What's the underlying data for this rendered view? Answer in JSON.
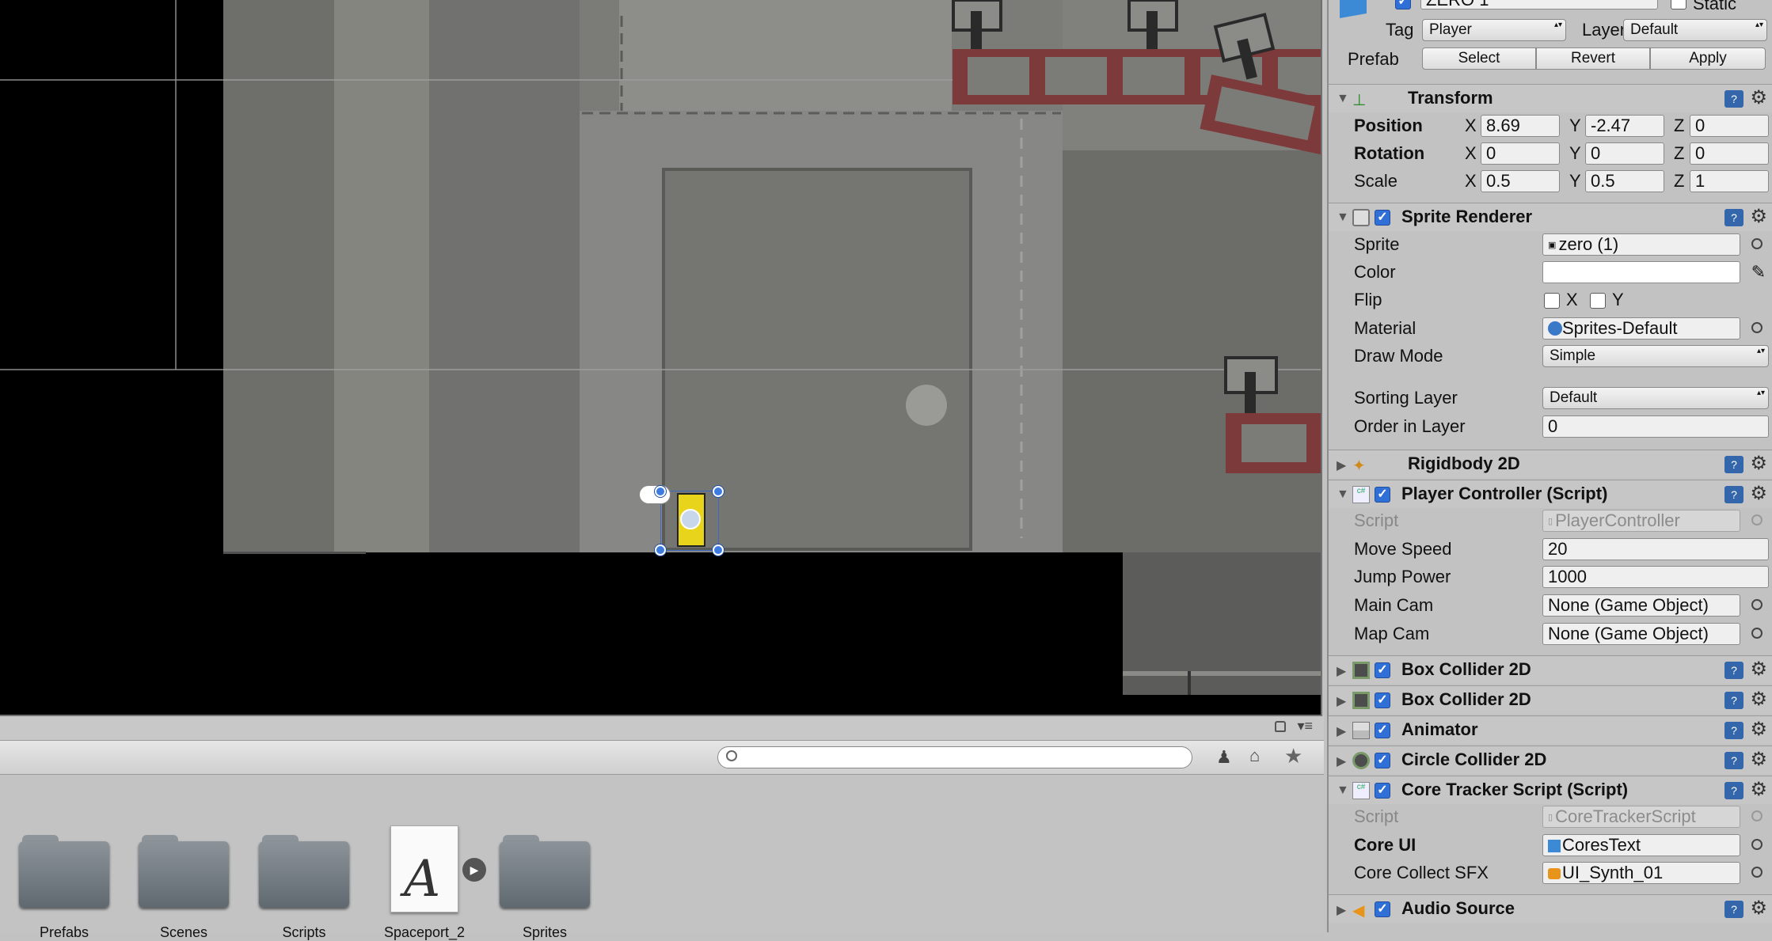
{
  "header": {
    "object_name": "ZERO 1",
    "static_label": "Static",
    "tag_label": "Tag",
    "tag_value": "Player",
    "layer_label": "Layer",
    "layer_value": "Default",
    "prefab_label": "Prefab",
    "select": "Select",
    "revert": "Revert",
    "apply": "Apply"
  },
  "transform": {
    "title": "Transform",
    "position_label": "Position",
    "rotation_label": "Rotation",
    "scale_label": "Scale",
    "x": "X",
    "y": "Y",
    "z": "Z",
    "position": {
      "x": "8.69",
      "y": "-2.47",
      "z": "0"
    },
    "rotation": {
      "x": "0",
      "y": "0",
      "z": "0"
    },
    "scale": {
      "x": "0.5",
      "y": "0.5",
      "z": "1"
    }
  },
  "sprite_renderer": {
    "title": "Sprite Renderer",
    "sprite_label": "Sprite",
    "sprite_value": "zero (1)",
    "color_label": "Color",
    "flip_label": "Flip",
    "flip_x": "X",
    "flip_y": "Y",
    "material_label": "Material",
    "material_value": "Sprites-Default",
    "draw_mode_label": "Draw Mode",
    "draw_mode_value": "Simple",
    "sorting_layer_label": "Sorting Layer",
    "sorting_layer_value": "Default",
    "order_label": "Order in Layer",
    "order_value": "0"
  },
  "rigidbody": {
    "title": "Rigidbody 2D"
  },
  "player_controller": {
    "title": "Player Controller (Script)",
    "script_label": "Script",
    "script_value": "PlayerController",
    "move_speed_label": "Move Speed",
    "move_speed_value": "20",
    "jump_power_label": "Jump Power",
    "jump_power_value": "1000",
    "main_cam_label": "Main Cam",
    "main_cam_value": "None (Game Object)",
    "map_cam_label": "Map Cam",
    "map_cam_value": "None (Game Object)"
  },
  "box_collider_1": {
    "title": "Box Collider 2D"
  },
  "box_collider_2": {
    "title": "Box Collider 2D"
  },
  "animator": {
    "title": "Animator"
  },
  "circle_collider": {
    "title": "Circle Collider 2D"
  },
  "core_tracker": {
    "title": "Core Tracker Script (Script)",
    "script_label": "Script",
    "script_value": "CoreTrackerScript",
    "core_ui_label": "Core UI",
    "core_ui_value": "CoresText",
    "sfx_label": "Core Collect SFX",
    "sfx_value": "UI_Synth_01"
  },
  "audio_source": {
    "title": "Audio Source"
  },
  "project": {
    "search_placeholder": "",
    "items": [
      {
        "label": "Prefabs",
        "type": "folder"
      },
      {
        "label": "Scenes",
        "type": "folder"
      },
      {
        "label": "Scripts",
        "type": "folder"
      },
      {
        "label": "Spaceport_2",
        "type": "font"
      },
      {
        "label": "Sprites",
        "type": "folder"
      }
    ]
  },
  "colors": {
    "scene_bg": "#000000",
    "wall_gray": "#777874",
    "rail_red": "#7d3a3a",
    "selection_blue": "#3d7be0",
    "inspector_bg": "#c2c2c2"
  }
}
